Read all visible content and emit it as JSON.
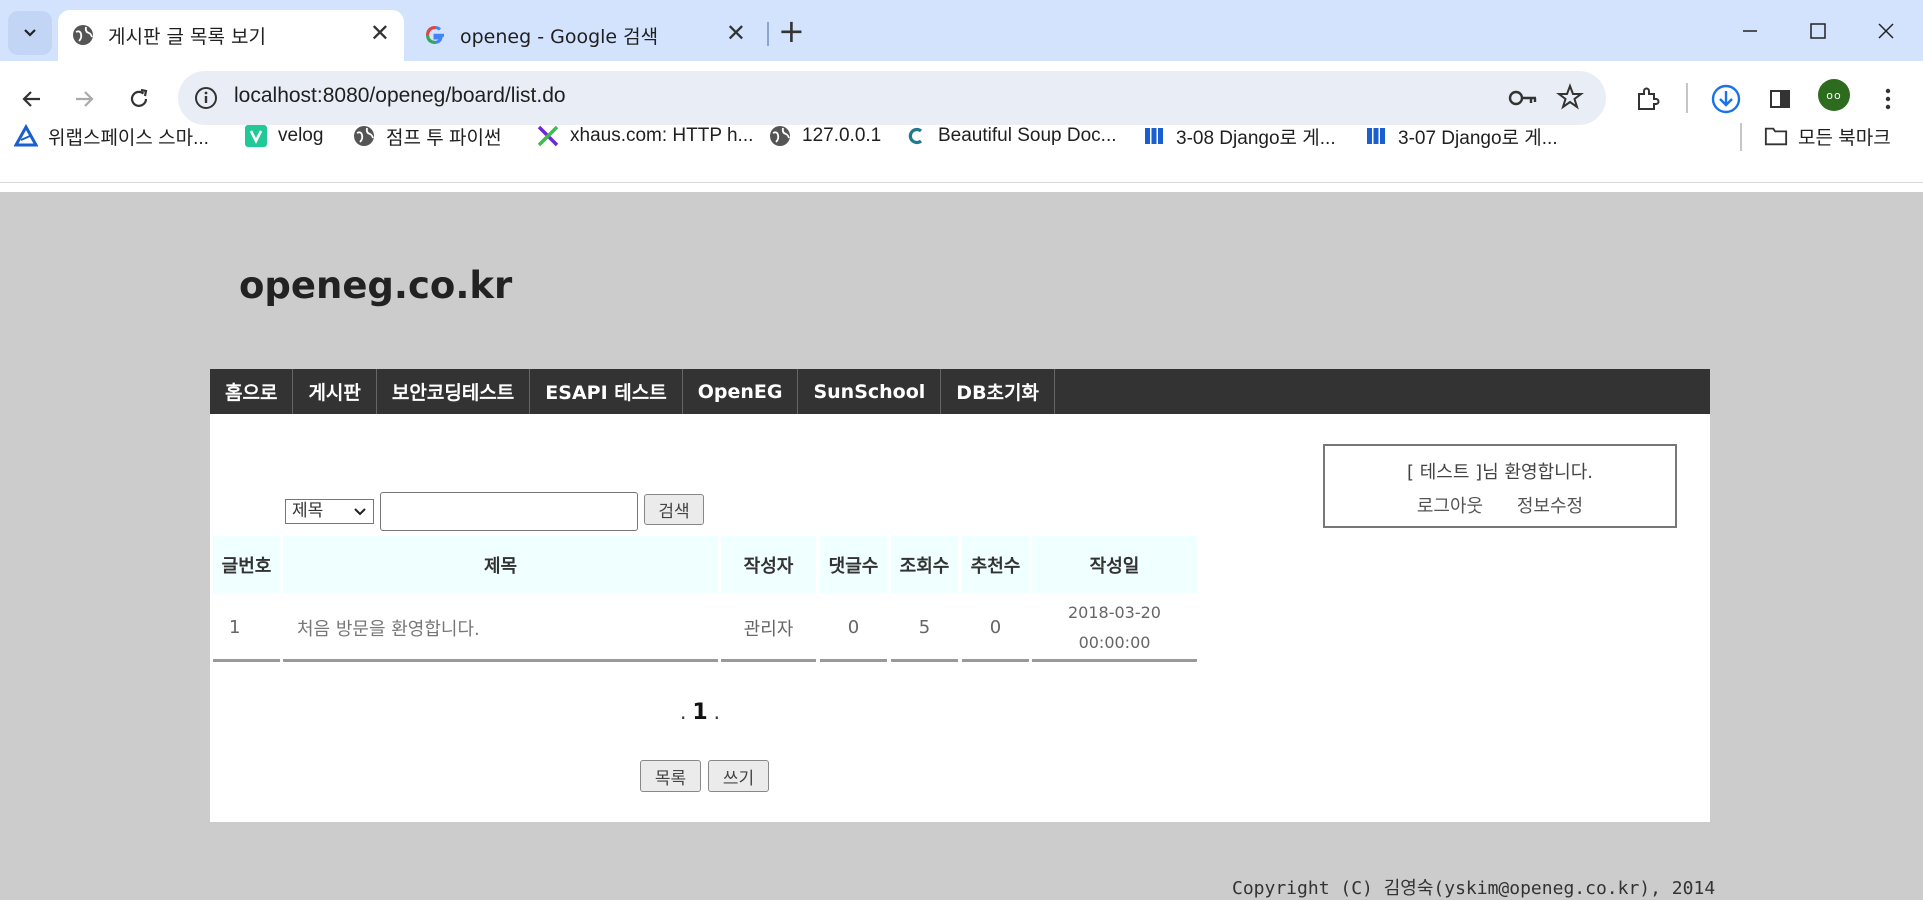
{
  "browser": {
    "tabs": [
      {
        "title": "게시판 글 목록 보기",
        "active": true,
        "favicon": "globe-icon"
      },
      {
        "title": "openeg - Google 검색",
        "active": false,
        "favicon": "google-icon"
      }
    ],
    "url": "localhost:8080/openeg/board/list.do",
    "bookmarks": [
      {
        "label": "위랩스페이스 스마...",
        "icon": "triangle-icon"
      },
      {
        "label": "velog",
        "icon": "velog-icon"
      },
      {
        "label": "점프 투 파이썬",
        "icon": "globe-icon"
      },
      {
        "label": "xhaus.com: HTTP h...",
        "icon": "x-icon"
      },
      {
        "label": "127.0.0.1",
        "icon": "globe-icon"
      },
      {
        "label": "Beautiful Soup Doc...",
        "icon": "c-icon"
      },
      {
        "label": "3-08 Django로 게...",
        "icon": "book-icon"
      },
      {
        "label": "3-07 Django로 게...",
        "icon": "book-icon"
      }
    ],
    "all_bookmarks": "모든 북마크",
    "avatar_text": "oo",
    "accent": "#d3e3fd"
  },
  "site": {
    "title": "openeg.co.kr",
    "menu": [
      "홈으로",
      "게시판",
      "보안코딩테스트",
      "ESAPI 테스트",
      "OpenEG",
      "SunSchool",
      "DB초기화"
    ],
    "login": {
      "welcome": "[ 테스트 ]님 환영합니다.",
      "logout": "로그아웃",
      "edit_info": "정보수정"
    },
    "search": {
      "select_value": "제목",
      "input_value": "",
      "button": "검색"
    },
    "table": {
      "headers": [
        "글번호",
        "제목",
        "작성자",
        "댓글수",
        "조회수",
        "추천수",
        "작성일"
      ],
      "rows": [
        {
          "no": "1",
          "title": "처음 방문을 환영합니다.",
          "writer": "관리자",
          "comments": "0",
          "views": "5",
          "likes": "0",
          "date": "2018-03-20",
          "time": "00:00:00"
        }
      ]
    },
    "pager": {
      "prefix": ".",
      "current": "1",
      "suffix": "."
    },
    "buttons": {
      "list": "목록",
      "write": "쓰기"
    },
    "copyright": "Copyright (C) 김영숙(yskim@openeg.co.kr), 2014"
  }
}
